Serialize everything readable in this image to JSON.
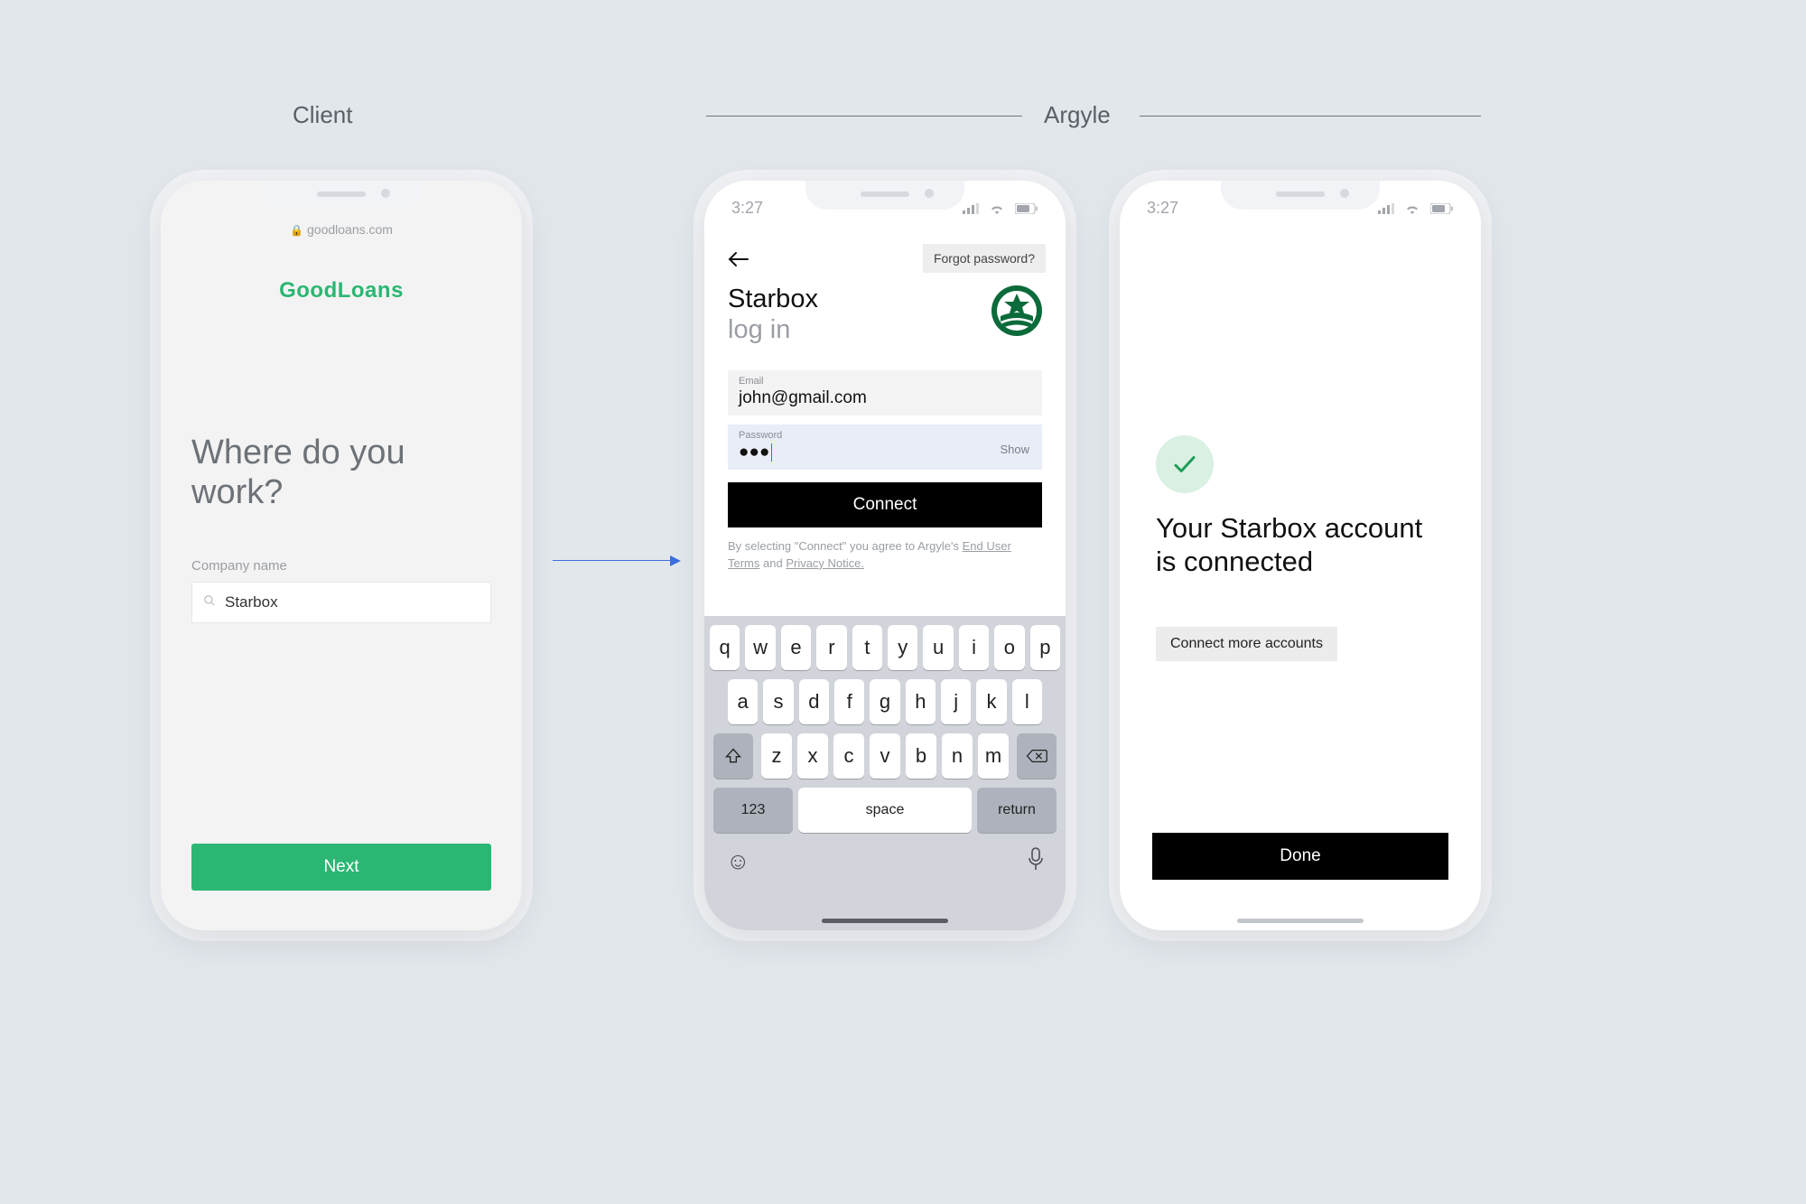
{
  "labels": {
    "client": "Client",
    "argyle": "Argyle"
  },
  "statusbar": {
    "time": "3:27"
  },
  "phone1": {
    "url": "goodloans.com",
    "brand_a": "Good",
    "brand_b": "Loans",
    "heading": "Where do you work?",
    "field_label": "Company name",
    "input_value": "Starbox",
    "next": "Next"
  },
  "phone2": {
    "forgot": "Forgot password?",
    "title": "Starbox",
    "subtitle": "log in",
    "email_label": "Email",
    "email_value": "john@gmail.com",
    "password_label": "Password",
    "password_value": "●●●",
    "show": "Show",
    "connect": "Connect",
    "legal_pre": "By selecting \"Connect\" you agree to Argyle's ",
    "legal_terms": "End User Terms",
    "legal_and": " and ",
    "legal_privacy": "Privacy Notice."
  },
  "keyboard": {
    "row1": [
      "q",
      "w",
      "e",
      "r",
      "t",
      "y",
      "u",
      "i",
      "o",
      "p"
    ],
    "row2": [
      "a",
      "s",
      "d",
      "f",
      "g",
      "h",
      "j",
      "k",
      "l"
    ],
    "row3": [
      "z",
      "x",
      "c",
      "v",
      "b",
      "n",
      "m"
    ],
    "k123": "123",
    "space": "space",
    "return": "return"
  },
  "phone3": {
    "message": "Your Starbox account is connected",
    "more": "Connect more accounts",
    "done": "Done"
  }
}
